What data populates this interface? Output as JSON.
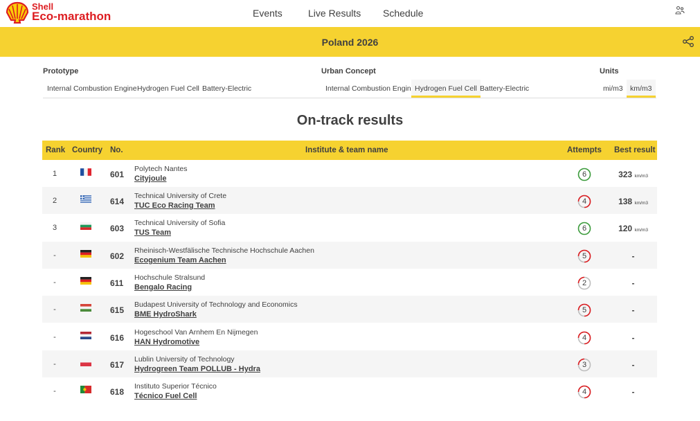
{
  "brand": {
    "line1": "Shell",
    "line2": "Eco-marathon"
  },
  "nav": [
    "Events",
    "Live Results",
    "Schedule"
  ],
  "event_title": "Poland 2026",
  "filters": {
    "prototype": {
      "label": "Prototype",
      "options": [
        "Internal Combustion Engine",
        "Hydrogen Fuel Cell",
        "Battery-Electric"
      ]
    },
    "urban": {
      "label": "Urban Concept",
      "options": [
        "Internal Combustion Engine",
        "Hydrogen Fuel Cell",
        "Battery-Electric"
      ],
      "selected": "Hydrogen Fuel Cell"
    },
    "units": {
      "label": "Units",
      "options": [
        "mi/m3",
        "km/m3"
      ],
      "selected": "km/m3"
    }
  },
  "page_title": "On-track results",
  "table": {
    "headers": {
      "rank": "Rank",
      "country": "Country",
      "no": "No.",
      "name": "Institute & team name",
      "attempts": "Attempts",
      "best": "Best result"
    },
    "unit": "km/m3",
    "rows": [
      {
        "rank": "1",
        "flag": "france",
        "no": "601",
        "institute": "Polytech Nantes",
        "team": "Cityjoule",
        "attempts": "6",
        "best": "323"
      },
      {
        "rank": "2",
        "flag": "greece",
        "no": "614",
        "institute": "Technical University of Crete",
        "team": "TUC Eco Racing Team",
        "attempts": "4",
        "best": "138"
      },
      {
        "rank": "3",
        "flag": "bulgaria",
        "no": "603",
        "institute": "Technical University of Sofia",
        "team": "TUS Team",
        "attempts": "6",
        "best": "120"
      },
      {
        "rank": "-",
        "flag": "germany",
        "no": "602",
        "institute": "Rheinisch-Westfälische Technische Hochschule Aachen",
        "team": "Ecogenium Team Aachen",
        "attempts": "5",
        "best": "-"
      },
      {
        "rank": "-",
        "flag": "germany",
        "no": "611",
        "institute": "Hochschule Stralsund",
        "team": "Bengalo Racing",
        "attempts": "2",
        "best": "-"
      },
      {
        "rank": "-",
        "flag": "hungary",
        "no": "615",
        "institute": "Budapest University of Technology and Economics",
        "team": "BME HydroShark",
        "attempts": "5",
        "best": "-"
      },
      {
        "rank": "-",
        "flag": "netherlands",
        "no": "616",
        "institute": "Hogeschool Van Arnhem En Nijmegen",
        "team": "HAN Hydromotive",
        "attempts": "4",
        "best": "-"
      },
      {
        "rank": "-",
        "flag": "poland",
        "no": "617",
        "institute": "Lublin University of Technology",
        "team": "Hydrogreen Team POLLUB - Hydra",
        "attempts": "3",
        "best": "-"
      },
      {
        "rank": "-",
        "flag": "portugal",
        "no": "618",
        "institute": "Instituto Superior Técnico",
        "team": "Técnico Fuel Cell",
        "attempts": "4",
        "best": "-"
      }
    ]
  },
  "colors": {
    "accent": "#f6d230",
    "brand_red": "#dd1d21",
    "success": "#3a9a3a",
    "warning": "#dd1d21",
    "text": "#404040"
  }
}
